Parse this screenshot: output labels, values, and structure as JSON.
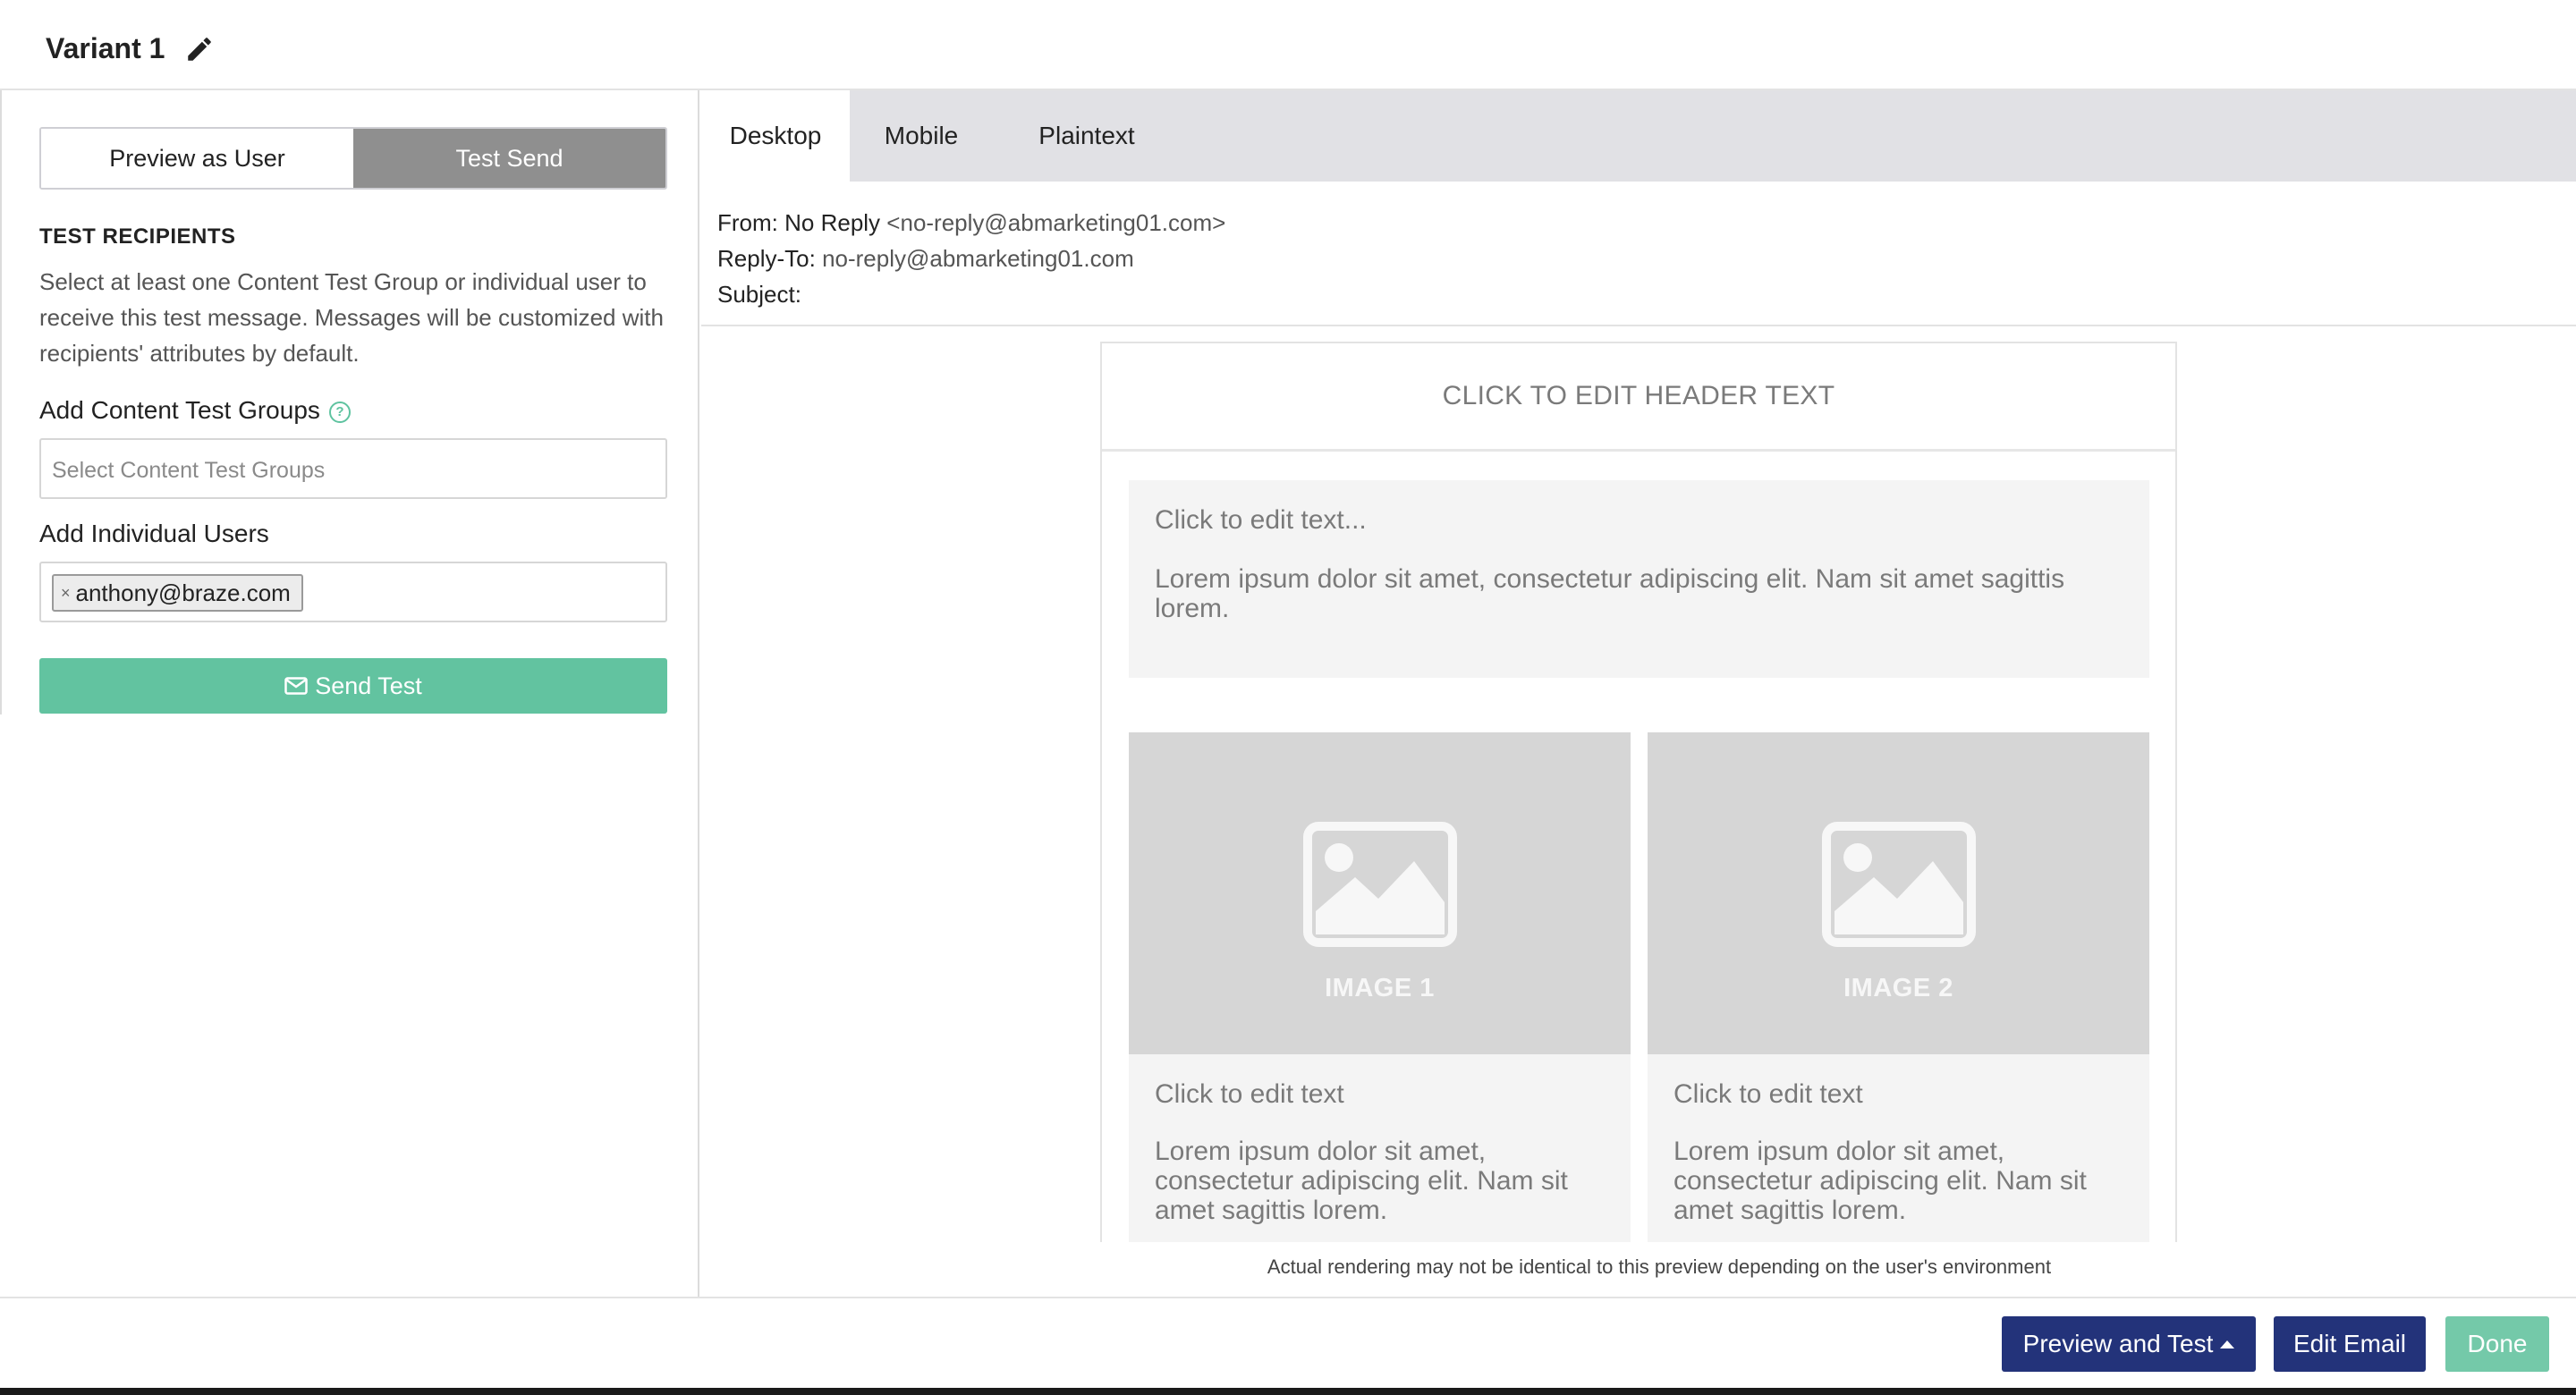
{
  "title": "Variant 1",
  "left_panel": {
    "mode_toggle": {
      "preview_as_user": "Preview as User",
      "test_send": "Test Send"
    },
    "test_recipients_heading": "TEST RECIPIENTS",
    "test_recipients_desc": "Select at least one Content Test Group or individual user to receive this test message. Messages will be customized with recipients' attributes by default.",
    "content_groups_label": "Add Content Test Groups",
    "help_icon_glyph": "?",
    "content_groups_placeholder": "Select Content Test Groups",
    "individual_users_label": "Add Individual Users",
    "selected_user": {
      "remove": "×",
      "email": "anthony@braze.com"
    },
    "send_test_label": "Send Test"
  },
  "preview_tabs": [
    "Desktop",
    "Mobile",
    "Plaintext"
  ],
  "email_headers": {
    "from_label": "From:",
    "from_name": "No Reply",
    "from_address": "<no-reply@abmarketing01.com>",
    "reply_to_label": "Reply-To:",
    "reply_to_value": "no-reply@abmarketing01.com",
    "subject_label": "Subject:"
  },
  "email_preview": {
    "header_text": "CLICK TO EDIT HEADER TEXT",
    "text_block": {
      "title": "Click to edit text...",
      "body": "Lorem ipsum dolor sit amet, consectetur adipiscing elit. Nam sit amet sagittis lorem."
    },
    "columns": [
      {
        "image_label": "IMAGE 1",
        "title": "Click to edit text",
        "body": "Lorem ipsum dolor sit amet, consectetur adipiscing elit. Nam sit amet sagittis lorem."
      },
      {
        "image_label": "IMAGE 2",
        "title": "Click to edit text",
        "body": "Lorem ipsum dolor sit amet, consectetur adipiscing elit. Nam sit amet sagittis lorem."
      }
    ]
  },
  "disclaimer": "Actual rendering may not be identical to this preview depending on the user's environment",
  "footer": {
    "preview_and_test": "Preview and Test",
    "edit_email": "Edit Email",
    "done": "Done"
  },
  "icons": {
    "edit_title": "pencil-icon",
    "help": "question-circle-icon",
    "send": "envelope-icon",
    "image_placeholder": "image-icon",
    "dropdown": "caret-up-icon"
  },
  "colors": {
    "primary_navy": "#23337a",
    "accent_green": "#62c3a0",
    "done_green": "#74c9a9",
    "active_toggle_gray": "#8f8f8f",
    "tabbar_gray": "#e1e1e5"
  }
}
